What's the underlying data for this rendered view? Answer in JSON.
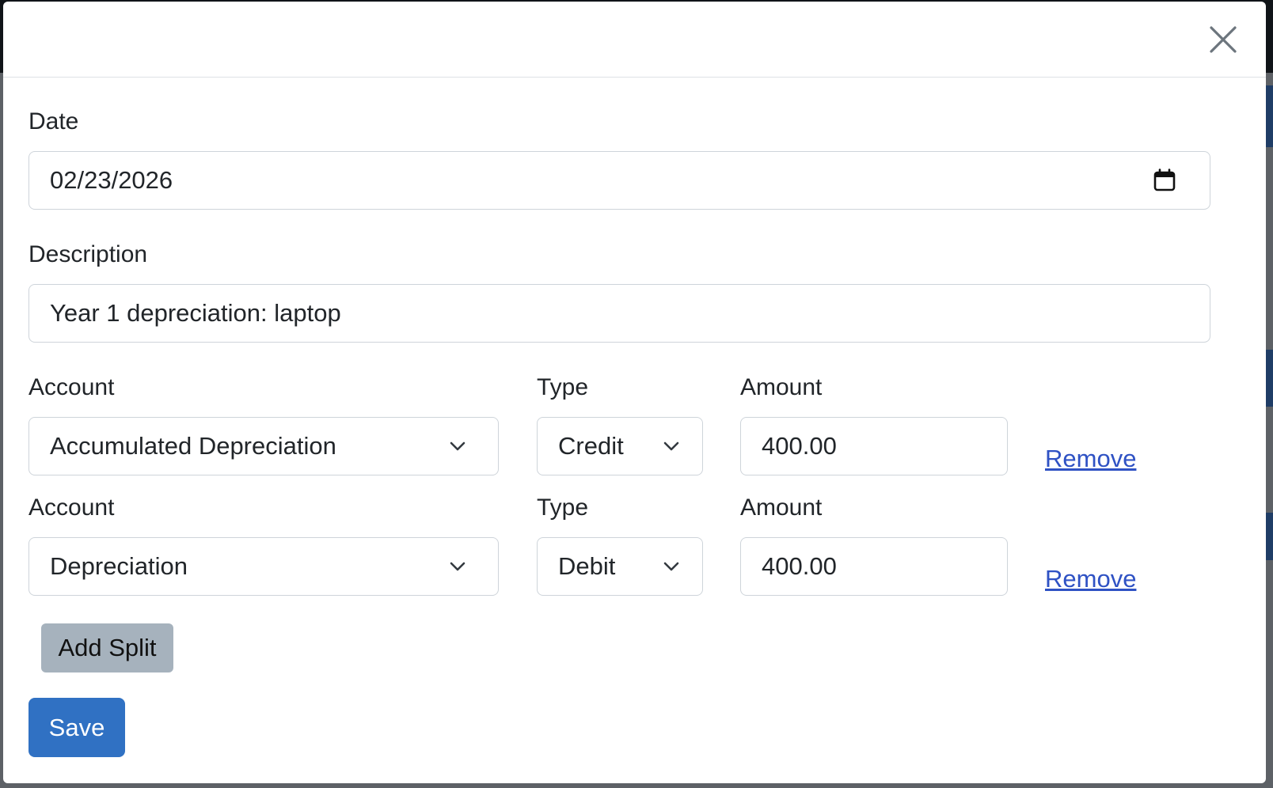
{
  "modal": {
    "close_icon": "close-icon"
  },
  "form": {
    "date": {
      "label": "Date",
      "value": "02/23/2026",
      "icon": "calendar-icon"
    },
    "description": {
      "label": "Description",
      "value": "Year 1 depreciation: laptop"
    },
    "splits": [
      {
        "account_label": "Account",
        "account_value": "Accumulated Depreciation",
        "type_label": "Type",
        "type_value": "Credit",
        "amount_label": "Amount",
        "amount_value": "400.00",
        "remove_label": "Remove"
      },
      {
        "account_label": "Account",
        "account_value": "Depreciation",
        "type_label": "Type",
        "type_value": "Debit",
        "amount_label": "Amount",
        "amount_value": "400.00",
        "remove_label": "Remove"
      }
    ],
    "add_split_label": "Add Split",
    "save_label": "Save"
  },
  "colors": {
    "primary": "#3071c3",
    "secondary": "#a6b2bd",
    "link": "#2f52c4",
    "border": "#ced4da"
  }
}
